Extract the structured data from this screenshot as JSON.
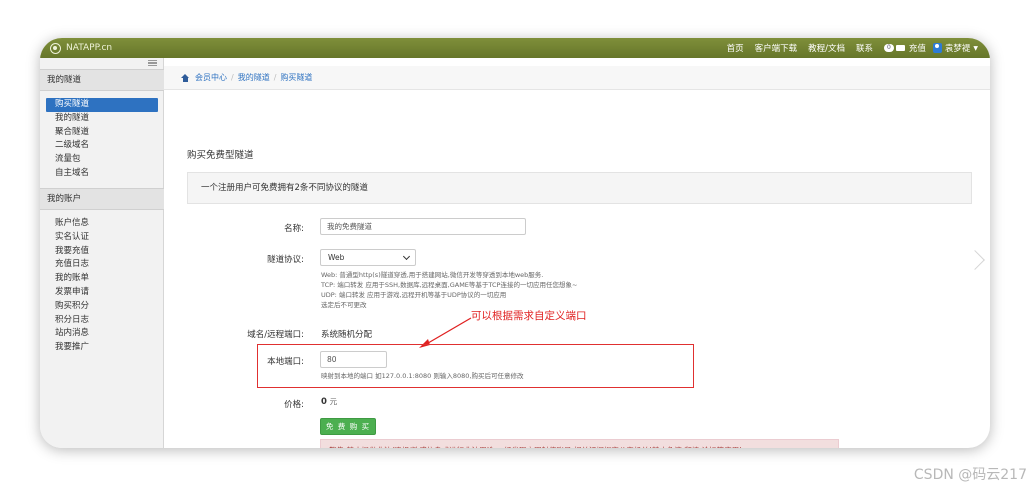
{
  "header": {
    "logo": "NATAPP.cn",
    "nav": [
      "首页",
      "客户端下载",
      "教程/文档",
      "联系"
    ],
    "message_count": "0",
    "recharge": "充值",
    "user_name": "袁梦褆"
  },
  "sidebar": {
    "group1_title": "我的隧道",
    "group1_items": [
      "购买隧道",
      "我的隧道",
      "聚合隧道",
      "二级域名",
      "流量包",
      "自主域名"
    ],
    "group2_title": "我的账户",
    "group2_items": [
      "账户信息",
      "实名认证",
      "我要充值",
      "充值日志",
      "我的账单",
      "发票申请",
      "购买积分",
      "积分日志",
      "站内消息",
      "我要推广"
    ]
  },
  "breadcrumb": [
    "会员中心",
    "我的隧道",
    "购买隧道"
  ],
  "page_title": "购买免费型隧道",
  "notice": "一个注册用户可免费拥有2条不同协议的隧道",
  "form": {
    "name_label": "名称:",
    "name_value": "我的免费隧道",
    "protocol_label": "隧道协议:",
    "protocol_value": "Web",
    "protocol_help": [
      "Web: 普通型http(s)隧道穿透,用于搭建网站,微信开发等穿透到本地web服务.",
      "TCP: 端口转发 应用于SSH,数据库,远程桌面,GAME等基于TCP连接的一切应用任您想象~",
      "UDP: 端口转发 应用于游戏,远程开机等基于UDP协议的一切应用",
      "选定后不可更改"
    ],
    "domain_label": "域名/远程端口:",
    "domain_value": "系统随机分配",
    "port_label": "本地端口:",
    "port_value": "80",
    "port_help": "映射到本地的端口 如127.0.0.1:8080 则输入8080,购买后可任意修改",
    "price_label": "价格:",
    "price_value": "0",
    "price_unit": "元",
    "buy_button": "免 费 购 买",
    "warning": "警告:禁止提供非法/违规/敏感信息或进行非法用途,一经发现立即封停账号,相关证据提交公安机关!禁止免流,翻墙,论坛等应用!"
  },
  "annotation": "可以根据需求自定义端口",
  "watermark": "CSDN @码云217"
}
